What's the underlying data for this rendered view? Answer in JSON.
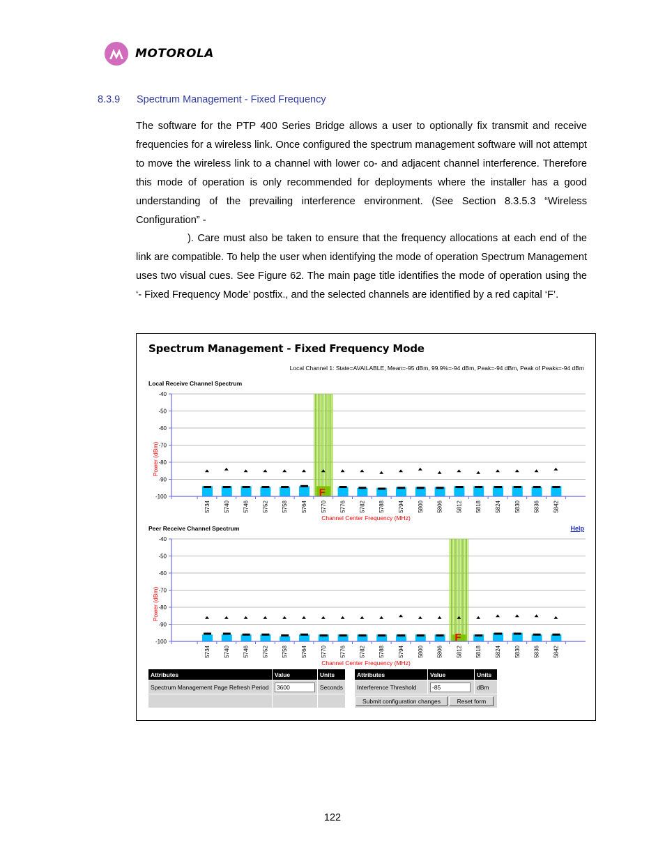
{
  "header": {
    "logo_icon": "motorola-batwing-icon",
    "logo_text": "MOTOROLA"
  },
  "section": {
    "number": "8.3.9",
    "title": "Spectrum Management - Fixed Frequency"
  },
  "body": {
    "para1_part1": "The software for the PTP 400 Series Bridge allows a user to optionally fix transmit and receive frequencies for a wireless link. Once configured the spectrum management software will not attempt to move the wireless link to a channel with lower co- and adjacent channel interference. Therefore this mode of operation is only recommended for deployments where the installer has a good understanding of the prevailing interference environment. (See Section 8.3.5.3 “Wireless Configuration” -",
    "para1_part2": "). Care must also be taken to ensure that the frequency allocations at each end of the link are compatible. To help the user when identifying the mode of operation Spectrum Management uses two visual cues. See Figure 62. The main page title identifies the mode of operation using the ‘- Fixed Frequency Mode’ postfix., and the selected channels are identified by a red capital ‘F’."
  },
  "figure": {
    "title": "Spectrum Management - Fixed Frequency Mode",
    "status_line": "Local Channel 1: State=AVAILABLE, Mean=-95 dBm, 99.9%=-94 dBm, Peak=-94 dBm, Peak of Peaks=-94 dBm",
    "help_label": "Help",
    "fixed_marker": "F",
    "colors": {
      "bar": "#00bfff",
      "peak_marker": "#000000",
      "fixed_band": "#7cc400",
      "fixed_marker": "#ff0000",
      "axis": "#6a6ae8",
      "axis_title": "#ff0000",
      "gridline": "#b8b8b8"
    }
  },
  "chart_data": [
    {
      "type": "bar",
      "title": "Local Receive Channel Spectrum",
      "xlabel": "Channel Center Frequency (MHz)",
      "ylabel": "Power (dBm)",
      "ylim": [
        -100,
        -40
      ],
      "yticks": [
        "-40",
        "-50",
        "-60",
        "-70",
        "-80",
        "-90",
        "-100"
      ],
      "grid": true,
      "categories": [
        "5734",
        "5740",
        "5746",
        "5752",
        "5758",
        "5764",
        "5770",
        "5776",
        "5782",
        "5788",
        "5794",
        "5800",
        "5806",
        "5812",
        "5818",
        "5824",
        "5830",
        "5836",
        "5842"
      ],
      "series": [
        {
          "name": "Mean",
          "values": [
            -94,
            -94,
            -94,
            -94.5,
            -94.5,
            -94,
            -94,
            -94.5,
            -95,
            -95,
            -94.5,
            -94.5,
            -94.5,
            -94,
            -94,
            -94,
            -94,
            -94.5,
            -94
          ]
        },
        {
          "name": "99.9%",
          "values": [
            -94.5,
            -94.5,
            -94.5,
            -94.5,
            -94.5,
            -94,
            -94.5,
            -94.5,
            -95,
            -95.5,
            -95,
            -95,
            -95,
            -94.5,
            -94.5,
            -94.5,
            -94.5,
            -94.5,
            -94.5
          ]
        },
        {
          "name": "Peak of Peaks",
          "values": [
            -85,
            -84,
            -85,
            -85,
            -85,
            -85,
            -85,
            -85,
            -85,
            -86,
            -85,
            -84,
            -86,
            -85,
            -86,
            -85,
            -85,
            -85,
            -84
          ]
        }
      ],
      "fixed_channel": "5770"
    },
    {
      "type": "bar",
      "title": "Peer Receive Channel Spectrum",
      "xlabel": "Channel Center Frequency (MHz)",
      "ylabel": "Power (dBm)",
      "ylim": [
        -100,
        -40
      ],
      "yticks": [
        "-40",
        "-50",
        "-60",
        "-70",
        "-80",
        "-90",
        "-100"
      ],
      "grid": true,
      "categories": [
        "5734",
        "5740",
        "5746",
        "5752",
        "5758",
        "5764",
        "5770",
        "5776",
        "5782",
        "5788",
        "5794",
        "5800",
        "5806",
        "5812",
        "5818",
        "5824",
        "5830",
        "5836",
        "5842"
      ],
      "series": [
        {
          "name": "Mean",
          "values": [
            -96,
            -96,
            -96,
            -96,
            -97,
            -96,
            -96,
            -96,
            -96,
            -96,
            -96,
            -96,
            -96,
            -96,
            -96,
            -95,
            -95,
            -96,
            -96
          ]
        },
        {
          "name": "99.9%",
          "values": [
            -95.5,
            -95.5,
            -96,
            -96,
            -96.5,
            -96,
            -96.5,
            -96.5,
            -96.5,
            -96.5,
            -96.5,
            -96.5,
            -96.5,
            -96,
            -96.5,
            -95.5,
            -95.5,
            -96,
            -96
          ]
        },
        {
          "name": "Peak of Peaks",
          "values": [
            -86,
            -86,
            -86,
            -86,
            -86,
            -86,
            -86,
            -86,
            -86,
            -86,
            -85,
            -86,
            -86,
            -86,
            -86,
            -85,
            -85,
            -85,
            -86
          ]
        }
      ],
      "fixed_channel": "5812"
    }
  ],
  "table_left": {
    "headers": [
      "Attributes",
      "Value",
      "Units"
    ],
    "rows": [
      {
        "attribute": "Spectrum Management Page Refresh Period",
        "value": "3600",
        "units": "Seconds"
      }
    ]
  },
  "table_right": {
    "headers": [
      "Attributes",
      "Value",
      "Units"
    ],
    "rows": [
      {
        "attribute": "Interference Threshold",
        "value": "-85",
        "units": "dBm"
      }
    ],
    "submit_label": "Submit configuration changes",
    "reset_label": "Reset form"
  },
  "footer": {
    "page_number": "122"
  }
}
